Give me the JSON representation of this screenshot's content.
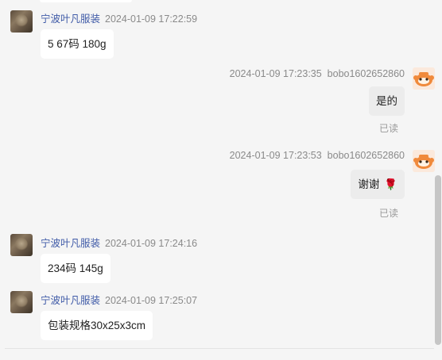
{
  "messages": [
    {
      "sender": "宁波叶凡服装",
      "time": "2024-01-09 17:22:59",
      "text": "5 67码 180g",
      "side": "left"
    },
    {
      "sender": "bobo1602652860",
      "time": "2024-01-09 17:23:35",
      "text": "是的",
      "side": "right",
      "status": "已读"
    },
    {
      "sender": "bobo1602652860",
      "time": "2024-01-09 17:23:53",
      "text": "谢谢",
      "emoji": "🌹",
      "side": "right",
      "status": "已读"
    },
    {
      "sender": "宁波叶凡服装",
      "time": "2024-01-09 17:24:16",
      "text": "234码 145g",
      "side": "left"
    },
    {
      "sender": "宁波叶凡服装",
      "time": "2024-01-09 17:25:07",
      "text": "包装规格30x25x3cm",
      "side": "left"
    }
  ],
  "icons": {
    "seller_avatar": "seller-avatar",
    "buyer_avatar": "orange-robot-avatar"
  },
  "colors": {
    "sender_name": "#3f5aa7",
    "timestamp": "#8a8a8a",
    "robot": "#f08a3c"
  }
}
